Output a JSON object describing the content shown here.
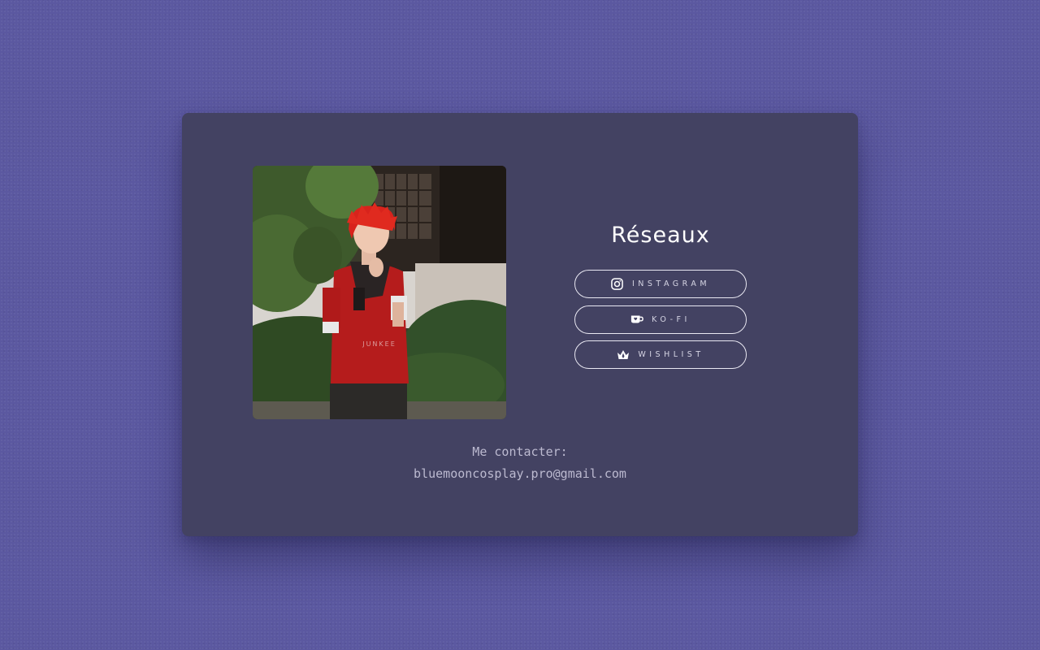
{
  "socials": {
    "title": "Réseaux",
    "items": [
      {
        "label": "INSTAGRAM",
        "icon": "instagram-icon"
      },
      {
        "label": "KO-FI",
        "icon": "kofi-cup-icon"
      },
      {
        "label": "WISHLIST",
        "icon": "crown-icon"
      }
    ]
  },
  "contact": {
    "label": "Me contacter:",
    "email": "bluemooncosplay.pro@gmail.com"
  },
  "photo": {
    "watermark": "JUNKEE"
  },
  "colors": {
    "background": "#5b58a0",
    "card": "#434262",
    "text": "#ffffff",
    "muted": "#bcbad0"
  }
}
